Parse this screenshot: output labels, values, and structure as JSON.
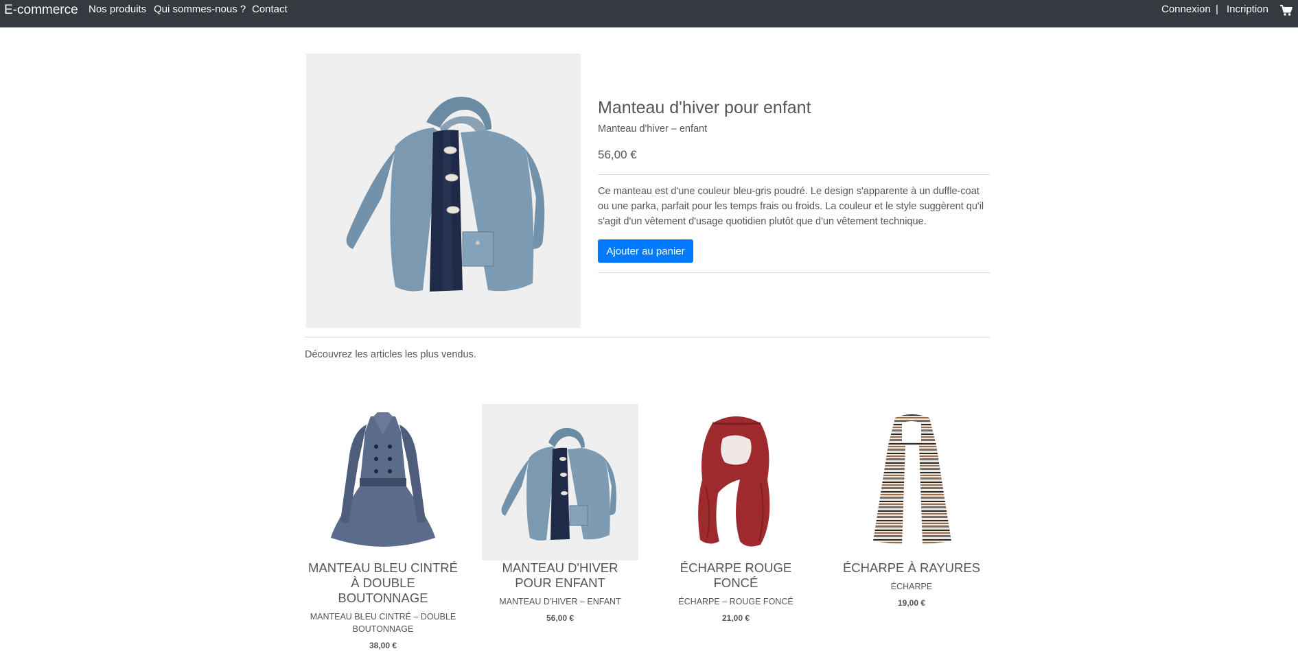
{
  "navbar": {
    "brand": "E-commerce",
    "links": [
      "Nos produits",
      "Qui sommes-nous ?",
      "Contact"
    ],
    "login": "Connexion",
    "separator": "|",
    "register": "Incription",
    "cart_icon": "cart-icon"
  },
  "product": {
    "title": "Manteau d'hiver pour enfant",
    "subtitle": "Manteau d'hiver – enfant",
    "price": "56,00 €",
    "description": "Ce manteau est d'une couleur bleu-gris poudré. Le design s'apparente à un duffle-coat ou une parka, parfait pour les temps frais ou froids. La couleur et le style suggèrent qu'il s'agit d'un vêtement d'usage quotidien plutôt que d'un vêtement technique.",
    "add_button": "Ajouter au panier"
  },
  "bestsellers": {
    "heading": "Découvrez les articles les plus vendus.",
    "items": [
      {
        "title": "MANTEAU BLEU CINTRÉ À DOUBLE BOUTONNAGE",
        "subtitle": "MANTEAU BLEU CINTRÉ – DOUBLE BOUTONNAGE",
        "price": "38,00 €"
      },
      {
        "title": "MANTEAU D'HIVER POUR ENFANT",
        "subtitle": "MANTEAU D'HIVER – ENFANT",
        "price": "56,00 €"
      },
      {
        "title": "ÉCHARPE ROUGE FONCÉ",
        "subtitle": "ÉCHARPE – ROUGE FONCÉ",
        "price": "21,00 €"
      },
      {
        "title": "ÉCHARPE À RAYURES",
        "subtitle": "ÉCHARPE",
        "price": "19,00 €"
      }
    ]
  },
  "colors": {
    "navbar_bg": "#343a40",
    "primary_button": "#007bff",
    "text": "#555555",
    "image_bg": "#efefef"
  }
}
